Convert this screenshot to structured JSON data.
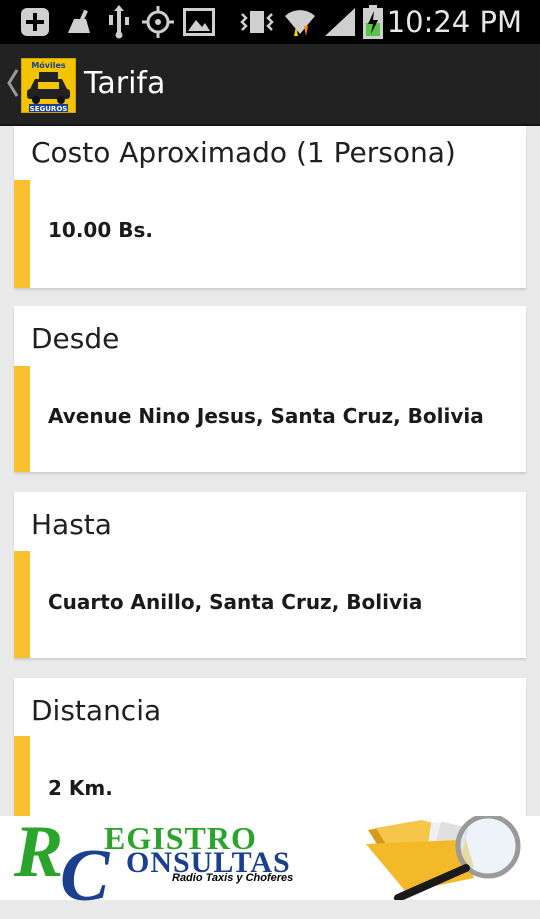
{
  "status_bar": {
    "time": "10:24 PM",
    "icons": [
      "add-icon",
      "cleaning-icon",
      "usb-icon",
      "gps-icon",
      "image-icon",
      "vibrate-icon",
      "wifi-icon",
      "signal-icon",
      "battery-charging-icon"
    ]
  },
  "action_bar": {
    "title": "Tarifa",
    "logo_text_top": "Móviles",
    "logo_text_bottom": "SEGUROS"
  },
  "cards": [
    {
      "label": "Costo Aproximado (1 Persona)",
      "value": "10.00 Bs."
    },
    {
      "label": "Desde",
      "value": "Avenue Nino Jesus, Santa Cruz, Bolivia"
    },
    {
      "label": "Hasta",
      "value": "Cuarto Anillo, Santa Cruz, Bolivia"
    },
    {
      "label": "Distancia",
      "value": "2 Km."
    }
  ],
  "banner": {
    "line1": "EGISTRO",
    "line2": "ONSULTAS",
    "subtitle": "Radio Taxis y Choferes",
    "monogram_r": "R",
    "monogram_c": "C"
  },
  "colors": {
    "accent": "#fbc02d",
    "actionbar": "#222222",
    "background": "#e9e9e9",
    "banner_green": "#2aa42a",
    "banner_blue": "#1a3f8f"
  }
}
